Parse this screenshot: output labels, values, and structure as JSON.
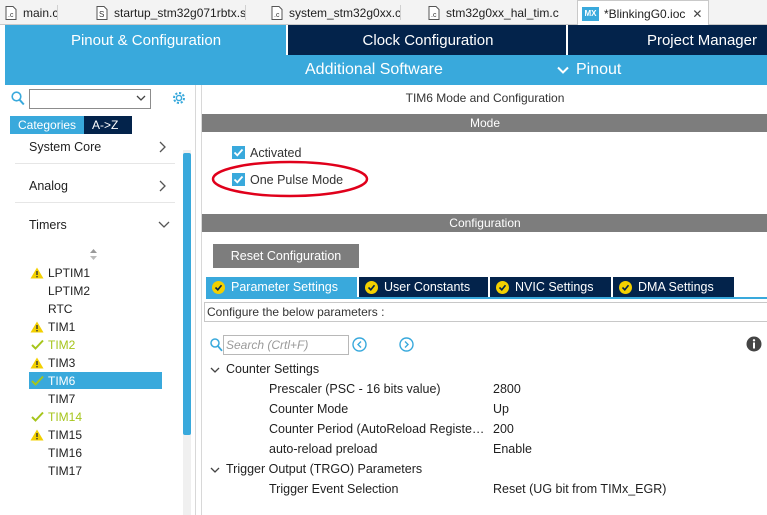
{
  "editor_tabs": [
    {
      "label": "main.c",
      "icon": "c-source-file-icon"
    },
    {
      "label": "startup_stm32g071rbtx.s",
      "icon": "asm-source-file-icon"
    },
    {
      "label": "system_stm32g0xx.c",
      "icon": "c-source-file-icon"
    },
    {
      "label": "stm32g0xx_hal_tim.c",
      "icon": "c-source-file-icon"
    },
    {
      "label": "*BlinkingG0.ioc",
      "icon": "mx-file-icon",
      "icon_text": "MX",
      "close": "✕"
    }
  ],
  "nav": {
    "tabs": [
      "Pinout & Configuration",
      "Clock Configuration",
      "Project Manager"
    ],
    "sub": {
      "additional_software": "Additional Software",
      "pinout": "Pinout",
      "pinout_chevron": "chevron-down-icon"
    }
  },
  "left": {
    "search_value": "",
    "cat_tabs": [
      "Categories",
      "A->Z"
    ],
    "sections": [
      "System Core",
      "Analog",
      "Timers"
    ],
    "timers": [
      {
        "label": "LPTIM1",
        "status": "warning"
      },
      {
        "label": "LPTIM2",
        "status": "none"
      },
      {
        "label": "RTC",
        "status": "none"
      },
      {
        "label": "TIM1",
        "status": "warning"
      },
      {
        "label": "TIM2",
        "status": "ok"
      },
      {
        "label": "TIM3",
        "status": "warning"
      },
      {
        "label": "TIM6",
        "status": "ok-selected"
      },
      {
        "label": "TIM7",
        "status": "none"
      },
      {
        "label": "TIM14",
        "status": "ok"
      },
      {
        "label": "TIM15",
        "status": "warning"
      },
      {
        "label": "TIM16",
        "status": "none"
      },
      {
        "label": "TIM17",
        "status": "none"
      }
    ]
  },
  "right": {
    "title": "TIM6 Mode and Configuration",
    "mode_header": "Mode",
    "mode": {
      "activated": "Activated",
      "one_pulse": "One Pulse Mode"
    },
    "config_header": "Configuration",
    "reset_button": "Reset Configuration",
    "tabs": [
      "Parameter Settings",
      "User Constants",
      "NVIC Settings",
      "DMA Settings"
    ],
    "configure_text": "Configure the below parameters :",
    "search_placeholder": "Search (Crtl+F)",
    "groups": [
      {
        "label": "Counter Settings",
        "params": [
          {
            "name": "Prescaler (PSC - 16 bits value)",
            "value": "2800"
          },
          {
            "name": "Counter Mode",
            "value": "Up"
          },
          {
            "name": "Counter Period (AutoReload Registe…",
            "value": "200"
          },
          {
            "name": "auto-reload preload",
            "value": "Enable"
          }
        ]
      },
      {
        "label": "Trigger Output (TRGO) Parameters",
        "params": [
          {
            "name": "Trigger Event Selection",
            "value": "Reset (UG bit from TIMx_EGR)"
          }
        ]
      }
    ]
  },
  "colors": {
    "nav_dark": "#03234b",
    "accent_blue": "#39a9dc",
    "section_gray": "#7d7d7d",
    "warning_yellow": "#f3d000",
    "ok_green": "#a6c51b",
    "annotation_red": "#e0001b"
  }
}
